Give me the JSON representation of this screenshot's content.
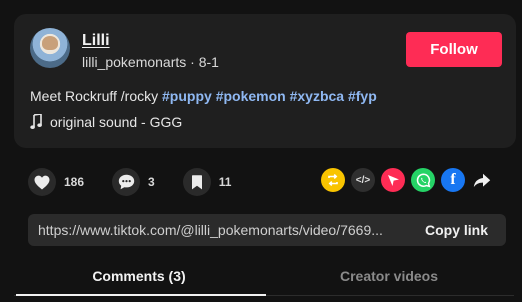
{
  "author": {
    "name": "Lilli",
    "handle": "lilli_pokemonarts",
    "separator": "·",
    "date": "8-1"
  },
  "follow_label": "Follow",
  "caption": {
    "text": "Meet Rockruff /rocky",
    "hashtags": [
      "#puppy",
      "#pokemon",
      "#xyzbca",
      "#fyp"
    ]
  },
  "sound": {
    "icon": "music-note-icon",
    "label": "original sound - GGG"
  },
  "actions": {
    "likes": {
      "icon": "heart-icon",
      "count": "186"
    },
    "comments": {
      "icon": "comment-bubble-icon",
      "count": "3"
    },
    "saves": {
      "icon": "bookmark-icon",
      "count": "11"
    }
  },
  "share": [
    {
      "name": "repost",
      "icon": "repost-icon",
      "color": "#f9c400"
    },
    {
      "name": "embed",
      "icon": "embed-code-icon",
      "glyph": "</>",
      "color": "#2f2f2f"
    },
    {
      "name": "send-to-friends",
      "icon": "paper-plane-icon",
      "color": "#fe2c55"
    },
    {
      "name": "whatsapp",
      "icon": "whatsapp-icon",
      "color": "#25d366"
    },
    {
      "name": "facebook",
      "icon": "facebook-icon",
      "glyph": "f",
      "color": "#1877f2"
    },
    {
      "name": "more",
      "icon": "share-arrow-icon"
    }
  ],
  "link": {
    "url": "https://www.tiktok.com/@lilli_pokemonarts/video/7669...",
    "copy_label": "Copy link"
  },
  "tabs": [
    {
      "label": "Comments (3)",
      "active": true
    },
    {
      "label": "Creator videos",
      "active": false
    }
  ],
  "colors": {
    "accent": "#fe2c55",
    "hashtag": "#8fb8f2",
    "background": "#121212",
    "card": "#1f1f1f"
  }
}
